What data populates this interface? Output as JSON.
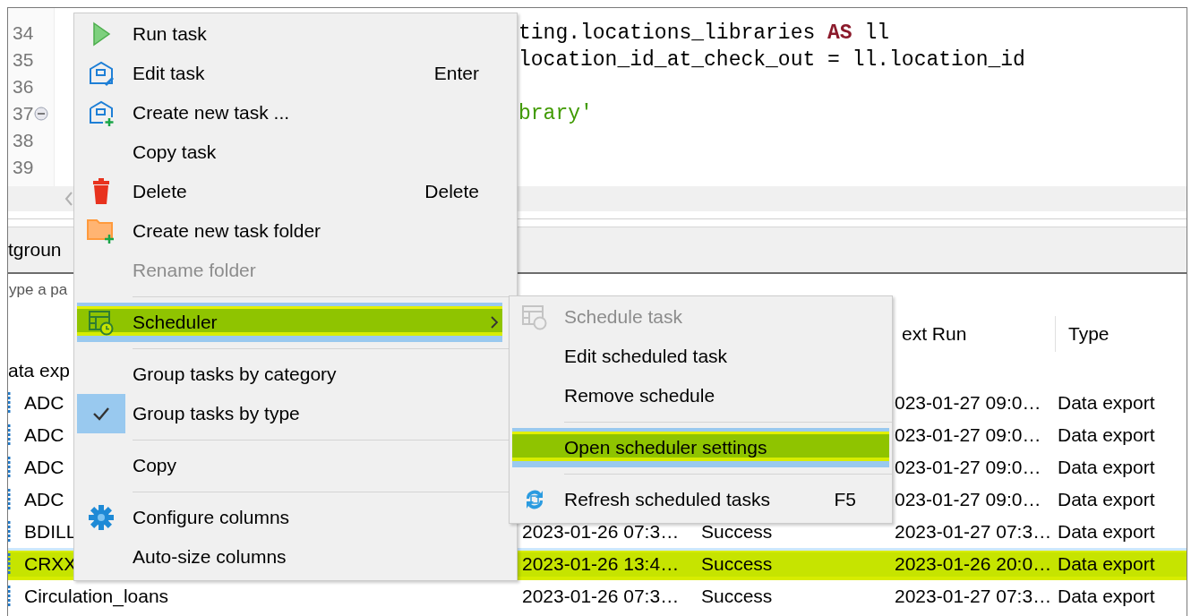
{
  "editor": {
    "lines": [
      {
        "number": "34",
        "foldable": false,
        "segments": [
          {
            "kind": "plain",
            "text": "ting.locations_libraries "
          },
          {
            "kind": "keyword",
            "text": "AS"
          },
          {
            "kind": "plain",
            "text": " ll"
          }
        ]
      },
      {
        "number": "35",
        "foldable": false,
        "segments": [
          {
            "kind": "plain",
            "text": "location_id_at_check_out = ll.location_id"
          }
        ]
      },
      {
        "number": "36",
        "foldable": false
      },
      {
        "number": "37",
        "foldable": true,
        "segments": [
          {
            "kind": "string",
            "text": "brary'"
          }
        ]
      },
      {
        "number": "38",
        "foldable": false
      },
      {
        "number": "39",
        "foldable": false
      }
    ]
  },
  "tabs": [
    {
      "label": "tgroun"
    }
  ],
  "search": {
    "placeholder": "ype a pa"
  },
  "table": {
    "columns": [
      {
        "label": "ext Run"
      },
      {
        "label": "Type"
      }
    ],
    "group": "ata exp",
    "rows": [
      {
        "name": "ADC",
        "next_run": "023-01-27 09:0…",
        "type": "Data export",
        "selected": false,
        "highlighted": false
      },
      {
        "name": "ADC",
        "next_run": "023-01-27 09:0…",
        "type": "Data export",
        "selected": false,
        "highlighted": false
      },
      {
        "name": "ADC",
        "next_run": "023-01-27 09:0…",
        "type": "Data export",
        "selected": false,
        "highlighted": false
      },
      {
        "name": "ADC",
        "next_run": "023-01-27 09:0…",
        "type": "Data export",
        "selected": false,
        "highlighted": false
      },
      {
        "name": "BDILL",
        "last_run": "2023-01-26 07:3…",
        "status": "Success",
        "next_run": "2023-01-27 07:3…",
        "type": "Data export",
        "selected": false,
        "highlighted": false
      },
      {
        "name": "CRXX",
        "last_run": "2023-01-26 13:4…",
        "status": "Success",
        "next_run": "2023-01-26 20:0…",
        "type": "Data export",
        "selected": true,
        "highlighted": true
      },
      {
        "name": "Circulation_loans",
        "last_run": "2023-01-26 07:3…",
        "status": "Success",
        "next_run": "2023-01-27 07:3…",
        "type": "Data export",
        "selected": false,
        "highlighted": false
      }
    ]
  },
  "context_menu": {
    "items": [
      {
        "kind": "item",
        "label": "Run task",
        "disabled": false,
        "selected": false,
        "highlighted": false,
        "checked": false,
        "has_submenu": false
      },
      {
        "kind": "item",
        "label": "Edit task",
        "shortcut": "Enter",
        "disabled": false,
        "selected": false,
        "highlighted": false,
        "checked": false,
        "has_submenu": false
      },
      {
        "kind": "item",
        "label": "Create new task ...",
        "disabled": false,
        "selected": false,
        "highlighted": false,
        "checked": false,
        "has_submenu": false
      },
      {
        "kind": "item",
        "label": "Copy task",
        "disabled": false,
        "selected": false,
        "highlighted": false,
        "checked": false,
        "has_submenu": false
      },
      {
        "kind": "item",
        "label": "Delete",
        "shortcut": "Delete",
        "disabled": false,
        "selected": false,
        "highlighted": false,
        "checked": false,
        "has_submenu": false
      },
      {
        "kind": "item",
        "label": "Create new task folder",
        "disabled": false,
        "selected": false,
        "highlighted": false,
        "checked": false,
        "has_submenu": false
      },
      {
        "kind": "item",
        "label": "Rename folder",
        "disabled": true,
        "selected": false,
        "highlighted": false,
        "checked": false,
        "has_submenu": false
      },
      {
        "kind": "separator"
      },
      {
        "kind": "item",
        "label": "Scheduler",
        "disabled": false,
        "selected": true,
        "highlighted": true,
        "checked": false,
        "has_submenu": true
      },
      {
        "kind": "separator"
      },
      {
        "kind": "item",
        "label": "Group tasks by category",
        "disabled": false,
        "selected": false,
        "highlighted": false,
        "checked": false,
        "has_submenu": false
      },
      {
        "kind": "item",
        "label": "Group tasks by type",
        "disabled": false,
        "selected": false,
        "highlighted": false,
        "checked": true,
        "has_submenu": false
      },
      {
        "kind": "separator"
      },
      {
        "kind": "item",
        "label": "Copy",
        "disabled": false,
        "selected": false,
        "highlighted": false,
        "checked": false,
        "has_submenu": false
      },
      {
        "kind": "separator"
      },
      {
        "kind": "item",
        "label": "Configure columns",
        "disabled": false,
        "selected": false,
        "highlighted": false,
        "checked": false,
        "has_submenu": false
      },
      {
        "kind": "item",
        "label": "Auto-size columns",
        "disabled": false,
        "selected": false,
        "highlighted": false,
        "checked": false,
        "has_submenu": false
      }
    ]
  },
  "submenu": {
    "items": [
      {
        "kind": "item",
        "label": "Schedule task",
        "disabled": true,
        "selected": false,
        "highlighted": false,
        "checked": false,
        "has_submenu": false
      },
      {
        "kind": "item",
        "label": "Edit scheduled task",
        "disabled": false,
        "selected": false,
        "highlighted": false,
        "checked": false,
        "has_submenu": false
      },
      {
        "kind": "item",
        "label": "Remove schedule",
        "disabled": false,
        "selected": false,
        "highlighted": false,
        "checked": false,
        "has_submenu": false
      },
      {
        "kind": "separator"
      },
      {
        "kind": "item",
        "label": "Open scheduler settings",
        "disabled": false,
        "selected": true,
        "highlighted": true,
        "checked": false,
        "has_submenu": false
      },
      {
        "kind": "separator"
      },
      {
        "kind": "item",
        "label": "Refresh scheduled tasks",
        "shortcut": "F5",
        "disabled": false,
        "selected": false,
        "highlighted": false,
        "checked": false,
        "has_submenu": false
      }
    ]
  }
}
